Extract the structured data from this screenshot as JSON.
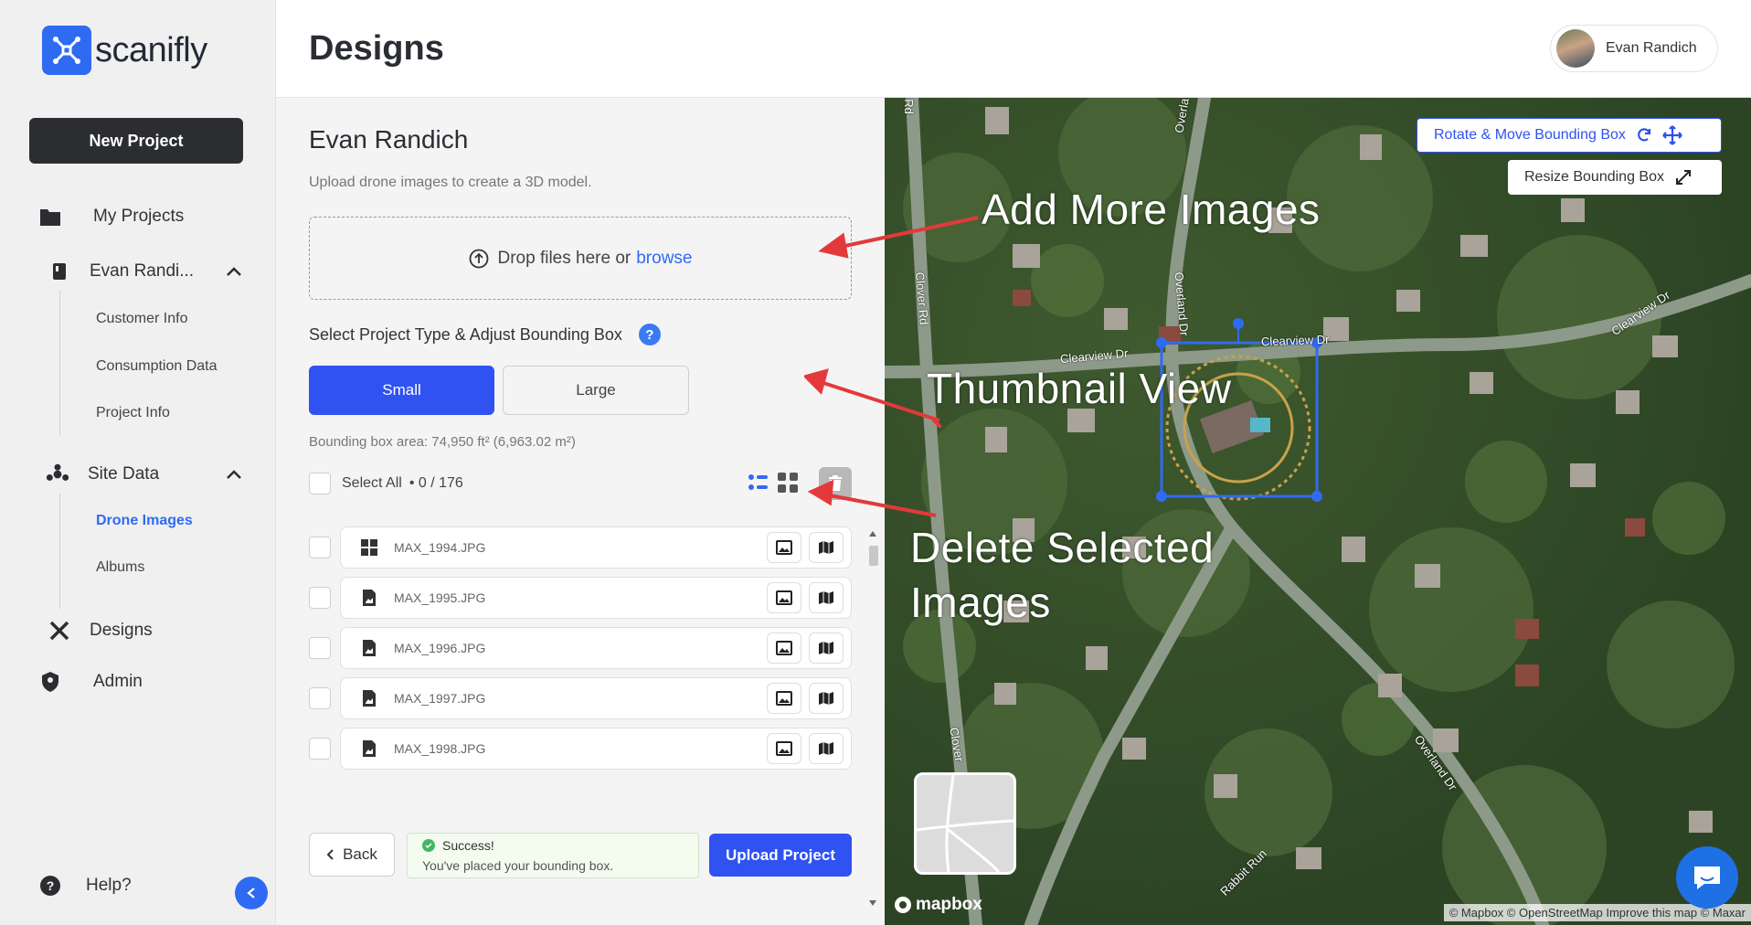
{
  "app": {
    "brand": "scanifly"
  },
  "sidebar": {
    "new_project": "New Project",
    "my_projects": "My Projects",
    "project_item": "Evan Randi...",
    "project_sub": [
      "Customer Info",
      "Consumption Data",
      "Project Info"
    ],
    "site_data": "Site Data",
    "site_sub": [
      "Drone Images",
      "Albums"
    ],
    "designs": "Designs",
    "admin": "Admin",
    "help": "Help?"
  },
  "header": {
    "title": "Designs",
    "user": "Evan Randich"
  },
  "panel": {
    "project_name": "Evan Randich",
    "subtitle": "Upload drone images to create a 3D model.",
    "drop_text": "Drop files here or",
    "browse": "browse",
    "section_title": "Select Project Type & Adjust Bounding Box",
    "help_mark": "?",
    "type_small": "Small",
    "type_large": "Large",
    "bbox_area": "Bounding box area: 74,950 ft² (6,963.02 m²)",
    "select_all": "Select All",
    "selection_count": "• 0 / 176",
    "files": [
      "MAX_1994.JPG",
      "MAX_1995.JPG",
      "MAX_1996.JPG",
      "MAX_1997.JPG",
      "MAX_1998.JPG"
    ],
    "back": "Back",
    "toast_title": "Success!",
    "toast_msg": "You've placed your bounding box.",
    "upload": "Upload Project"
  },
  "map": {
    "rotate_move": "Rotate & Move Bounding Box",
    "resize": "Resize Bounding Box",
    "annotations": [
      "Add More Images",
      "Thumbnail View",
      "Delete Selected",
      "Images"
    ],
    "roads": [
      "Rd",
      "Overla",
      "Clover Rd",
      "Overland Dr",
      "Clearview Dr",
      "Clearview Dr",
      "Clearview Dr",
      "Clover",
      "Overland Dr",
      "Rabbit Run"
    ],
    "mapbox": "mapbox",
    "attribution": "© Mapbox © OpenStreetMap Improve this map © Maxar"
  },
  "colors": {
    "accent": "#2f52f0",
    "sidebar_bg": "#f0f0f1",
    "dark_button": "#2b2d31",
    "success": "#3fb863"
  }
}
